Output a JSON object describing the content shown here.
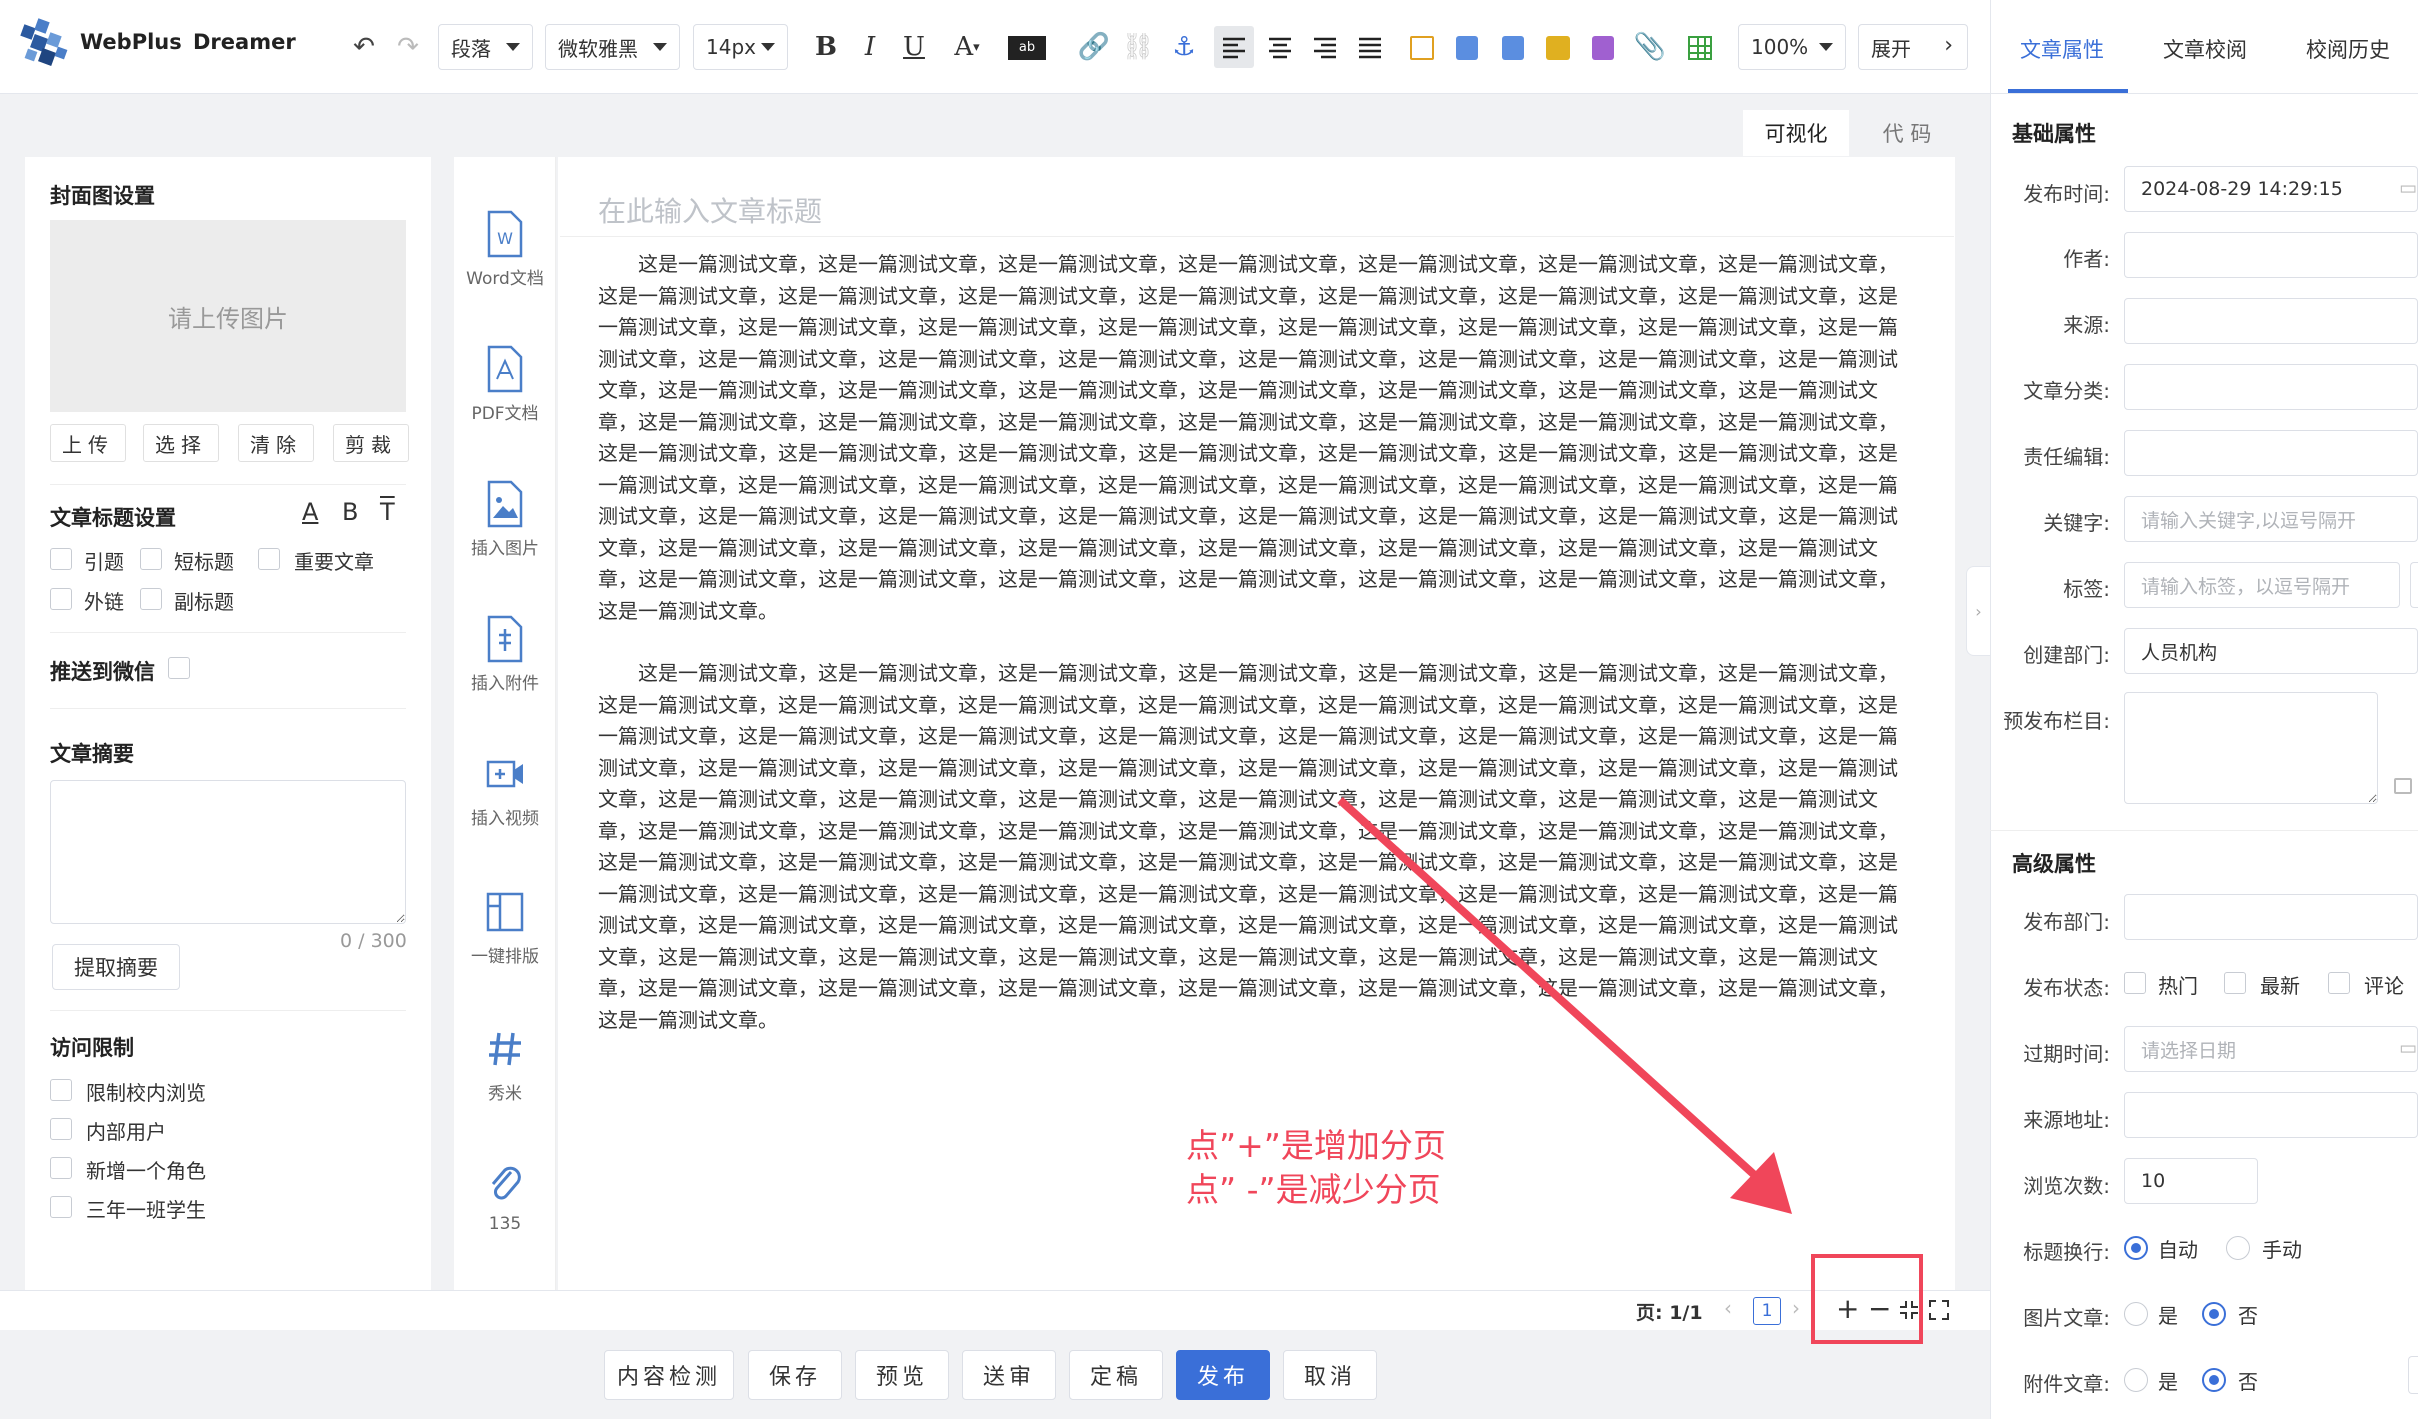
{
  "brand": {
    "name": "WebPlus",
    "product": "Dreamer"
  },
  "toolbar": {
    "paragraph": "段落",
    "font": "微软雅黑",
    "size": "14px",
    "zoom": "100%",
    "expand": "展开",
    "bold": "B",
    "italic": "I",
    "underline": "U"
  },
  "view_tabs": {
    "visual": "可视化",
    "code": "代 码"
  },
  "editor": {
    "title_placeholder": "在此输入文章标题",
    "paragraphs": [
      "这是一篇测试文章，这是一篇测试文章，这是一篇测试文章，这是一篇测试文章，这是一篇测试文章，这是一篇测试文章，这是一篇测试文章，这是一篇测试文章，这是一篇测试文章，这是一篇测试文章，这是一篇测试文章，这是一篇测试文章，这是一篇测试文章，这是一篇测试文章，这是一篇测试文章，这是一篇测试文章，这是一篇测试文章，这是一篇测试文章，这是一篇测试文章，这是一篇测试文章，这是一篇测试文章，这是一篇测试文章，这是一篇测试文章，这是一篇测试文章，这是一篇测试文章，这是一篇测试文章，这是一篇测试文章，这是一篇测试文章，这是一篇测试文章，这是一篇测试文章，这是一篇测试文章，这是一篇测试文章，这是一篇测试文章，这是一篇测试文章，这是一篇测试文章，这是一篇测试文章，这是一篇测试文章，这是一篇测试文章，这是一篇测试文章，这是一篇测试文章，这是一篇测试文章，这是一篇测试文章，这是一篇测试文章，这是一篇测试文章，这是一篇测试文章，这是一篇测试文章，这是一篇测试文章，这是一篇测试文章，这是一篇测试文章，这是一篇测试文章，这是一篇测试文章，这是一篇测试文章，这是一篇测试文章，这是一篇测试文章，这是一篇测试文章，这是一篇测试文章，这是一篇测试文章，这是一篇测试文章，这是一篇测试文章，这是一篇测试文章，这是一篇测试文章，这是一篇测试文章，这是一篇测试文章，这是一篇测试文章，这是一篇测试文章，这是一篇测试文章，这是一篇测试文章，这是一篇测试文章，这是一篇测试文章，这是一篇测试文章，这是一篇测试文章，这是一篇测试文章，这是一篇测试文章，这是一篇测试文章，这是一篇测试文章，这是一篇测试文章，这是一篇测试文章，这是一篇测试文章，这是一篇测试文章，这是一篇测试文章。",
      "这是一篇测试文章，这是一篇测试文章，这是一篇测试文章，这是一篇测试文章，这是一篇测试文章，这是一篇测试文章，这是一篇测试文章，这是一篇测试文章，这是一篇测试文章，这是一篇测试文章，这是一篇测试文章，这是一篇测试文章，这是一篇测试文章，这是一篇测试文章，这是一篇测试文章，这是一篇测试文章，这是一篇测试文章，这是一篇测试文章，这是一篇测试文章，这是一篇测试文章，这是一篇测试文章，这是一篇测试文章，这是一篇测试文章，这是一篇测试文章，这是一篇测试文章，这是一篇测试文章，这是一篇测试文章，这是一篇测试文章，这是一篇测试文章，这是一篇测试文章，这是一篇测试文章，这是一篇测试文章，这是一篇测试文章，这是一篇测试文章，这是一篇测试文章，这是一篇测试文章，这是一篇测试文章，这是一篇测试文章，这是一篇测试文章，这是一篇测试文章，这是一篇测试文章，这是一篇测试文章，这是一篇测试文章，这是一篇测试文章，这是一篇测试文章，这是一篇测试文章，这是一篇测试文章，这是一篇测试文章，这是一篇测试文章，这是一篇测试文章，这是一篇测试文章，这是一篇测试文章，这是一篇测试文章，这是一篇测试文章，这是一篇测试文章，这是一篇测试文章，这是一篇测试文章，这是一篇测试文章，这是一篇测试文章，这是一篇测试文章，这是一篇测试文章，这是一篇测试文章，这是一篇测试文章，这是一篇测试文章，这是一篇测试文章，这是一篇测试文章，这是一篇测试文章，这是一篇测试文章，这是一篇测试文章，这是一篇测试文章，这是一篇测试文章，这是一篇测试文章，这是一篇测试文章，这是一篇测试文章，这是一篇测试文章，这是一篇测试文章，这是一篇测试文章，这是一篇测试文章，这是一篇测试文章，这是一篇测试文章。"
    ]
  },
  "insert_tools": [
    "Word文档",
    "PDF文档",
    "插入图片",
    "插入附件",
    "插入视频",
    "一键排版",
    "秀米",
    "135"
  ],
  "left": {
    "cover_title": "封面图设置",
    "upload_placeholder": "请上传图片",
    "cover_buttons": [
      "上传",
      "选择",
      "清除",
      "剪裁"
    ],
    "title_settings": "文章标题设置",
    "format_icons": [
      "A",
      "B",
      "T"
    ],
    "title_options": [
      "引题",
      "短标题",
      "重要文章",
      "外链",
      "副标题"
    ],
    "push_wechat": "推送到微信",
    "summary_title": "文章摘要",
    "summary_count": "0 / 300",
    "extract_button": "提取摘要",
    "access_title": "访问限制",
    "access_options": [
      "限制校内浏览",
      "内部用户",
      "新增一个角色",
      "三年一班学生"
    ]
  },
  "status": {
    "page_label": "页: 1/1",
    "current_page": "1",
    "plus": "+",
    "minus": "−"
  },
  "bottom_buttons": [
    "内容检测",
    "保存",
    "预览",
    "送审",
    "定稿",
    "发布",
    "取消"
  ],
  "annotation": {
    "line1": "点”+”是增加分页",
    "line2": "点” -”是减少分页"
  },
  "right": {
    "tabs": [
      "文章属性",
      "文章校阅",
      "校阅历史"
    ],
    "basic_title": "基础属性",
    "labels": [
      "发布时间:",
      "作者:",
      "来源:",
      "文章分类:",
      "责任编辑:",
      "关键字:",
      "标签:",
      "创建部门:",
      "预发布栏目:"
    ],
    "publish_time": "2024-08-29 14:29:15",
    "keywords_placeholder": "请输入关键字,以逗号隔开",
    "tags_placeholder": "请输入标签，以逗号隔开",
    "department": "人员机构",
    "advanced_title": "高级属性",
    "adv_labels": [
      "发布部门:",
      "发布状态:",
      "过期时间:",
      "来源地址:",
      "浏览次数:",
      "标题换行:",
      "图片文章:",
      "附件文章:"
    ],
    "status_options": [
      "热门",
      "最新",
      "评论"
    ],
    "expire_placeholder": "请选择日期",
    "views": "10",
    "wrap_options": [
      "自动",
      "手动"
    ],
    "yes": "是",
    "no": "否"
  },
  "colors": {
    "accent": "#3a6fd8",
    "annotation": "#f0465a"
  }
}
